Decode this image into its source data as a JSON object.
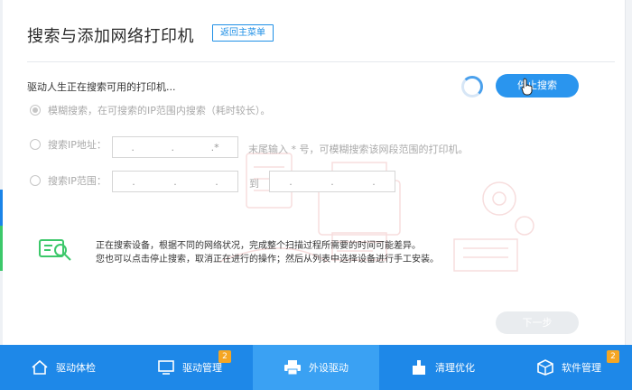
{
  "dialog": {
    "title": "搜索与添加网络打印机",
    "back_label": "返回主菜单",
    "status": "驱动人生正在搜索可用的打印机...",
    "stop_label": "停止搜索",
    "next_label": "下一步"
  },
  "options": {
    "fuzzy": {
      "text": "模糊搜索，在可搜索的IP范围内搜索（耗时较长）。",
      "checked": true
    },
    "ip_address": {
      "label": "搜索IP地址：",
      "value": ".   .   .*",
      "hint": "末尾输入 * 号，可模糊搜索该网段范围的打印机。"
    },
    "ip_range": {
      "label": "搜索IP范围：",
      "from": ".   .   .",
      "to_label": "到",
      "to": ".   .   ."
    }
  },
  "info": {
    "line1": "正在搜索设备，根据不同的网络状况，完成整个扫描过程所需要的时间可能差异。",
    "line2": "您也可以点击停止搜索，取消正在进行的操作；然后从列表中选择设备进行手工安装。"
  },
  "nav": [
    {
      "label": "驱动体检",
      "icon": "house-icon",
      "badge": ""
    },
    {
      "label": "驱动管理",
      "icon": "monitor-icon",
      "badge": "2"
    },
    {
      "label": "外设驱动",
      "icon": "printer-icon",
      "badge": "",
      "active": true
    },
    {
      "label": "清理优化",
      "icon": "broom-icon",
      "badge": ""
    },
    {
      "label": "软件管理",
      "icon": "software-box-icon",
      "badge": "2"
    }
  ],
  "colors": {
    "accent": "#2a95ee",
    "nav_bg": "#1e88e8",
    "nav_active": "#3aa1f3",
    "badge": "#f5a623",
    "info_icon": "#3cc86a"
  }
}
